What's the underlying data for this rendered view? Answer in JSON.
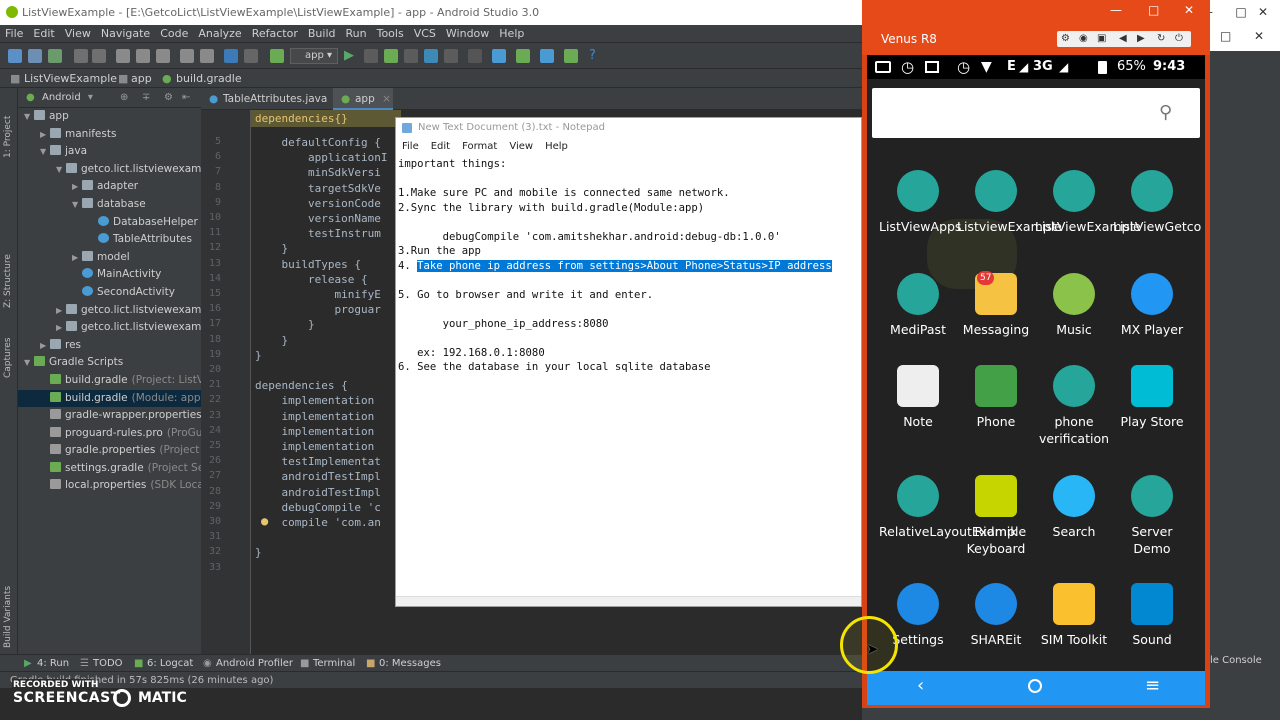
{
  "window": {
    "title": "ListViewExample - [E:\\GetcoLict\\ListViewExample\\ListViewExample] - app - Android Studio 3.0"
  },
  "menu": [
    "File",
    "Edit",
    "View",
    "Navigate",
    "Code",
    "Analyze",
    "Refactor",
    "Build",
    "Run",
    "Tools",
    "VCS",
    "Window",
    "Help"
  ],
  "toolbar": {
    "run_config": "app"
  },
  "breadcrumb": [
    "ListViewExample",
    "app",
    "build.gradle"
  ],
  "project": {
    "view": "Android",
    "items": [
      {
        "label": "app",
        "depth": 0,
        "arrow": "▼",
        "kind": "folder"
      },
      {
        "label": "manifests",
        "depth": 1,
        "arrow": "▶",
        "kind": "folder"
      },
      {
        "label": "java",
        "depth": 1,
        "arrow": "▼",
        "kind": "folder"
      },
      {
        "label": "getco.lict.listviewexample",
        "depth": 2,
        "arrow": "▼",
        "kind": "folder"
      },
      {
        "label": "adapter",
        "depth": 3,
        "arrow": "▶",
        "kind": "folder"
      },
      {
        "label": "database",
        "depth": 3,
        "arrow": "▼",
        "kind": "folder"
      },
      {
        "label": "DatabaseHelper",
        "depth": 4,
        "arrow": "",
        "kind": "class"
      },
      {
        "label": "TableAttributes",
        "depth": 4,
        "arrow": "",
        "kind": "class"
      },
      {
        "label": "model",
        "depth": 3,
        "arrow": "▶",
        "kind": "folder"
      },
      {
        "label": "MainActivity",
        "depth": 3,
        "arrow": "",
        "kind": "class"
      },
      {
        "label": "SecondActivity",
        "depth": 3,
        "arrow": "",
        "kind": "class"
      },
      {
        "label": "getco.lict.listviewexample",
        "depth": 2,
        "arrow": "▶",
        "kind": "folder"
      },
      {
        "label": "getco.lict.listviewexample",
        "depth": 2,
        "arrow": "▶",
        "kind": "folder"
      },
      {
        "label": "res",
        "depth": 1,
        "arrow": "▶",
        "kind": "folder"
      },
      {
        "label": "Gradle Scripts",
        "depth": 0,
        "arrow": "▼",
        "kind": "gradle"
      },
      {
        "label": "build.gradle",
        "depth": 1,
        "arrow": "",
        "kind": "gradle",
        "note": "(Project: ListVi"
      },
      {
        "label": "build.gradle",
        "depth": 1,
        "arrow": "",
        "kind": "gradle",
        "note": "(Module: app)",
        "selected": true
      },
      {
        "label": "gradle-wrapper.properties",
        "depth": 1,
        "arrow": "",
        "kind": "prop",
        "note": "(G"
      },
      {
        "label": "proguard-rules.pro",
        "depth": 1,
        "arrow": "",
        "kind": "prop",
        "note": "(ProGua"
      },
      {
        "label": "gradle.properties",
        "depth": 1,
        "arrow": "",
        "kind": "prop",
        "note": "(Project Pr"
      },
      {
        "label": "settings.gradle",
        "depth": 1,
        "arrow": "",
        "kind": "gradle",
        "note": "(Project Settin"
      },
      {
        "label": "local.properties",
        "depth": 1,
        "arrow": "",
        "kind": "prop",
        "note": "(SDK Locati"
      }
    ]
  },
  "tabs": [
    {
      "label": "TableAttributes.java"
    },
    {
      "label": "app"
    }
  ],
  "editor": {
    "breadcrumb": "dependencies{}",
    "lines": [
      {
        "n": "5",
        "t": "    defaultConfig {"
      },
      {
        "n": "6",
        "t": "        applicationI"
      },
      {
        "n": "7",
        "t": "        minSdkVersi"
      },
      {
        "n": "8",
        "t": "        targetSdkVe"
      },
      {
        "n": "9",
        "t": "        versionCode"
      },
      {
        "n": "10",
        "t": "        versionName"
      },
      {
        "n": "11",
        "t": "        testInstrum"
      },
      {
        "n": "12",
        "t": "    }"
      },
      {
        "n": "13",
        "t": "    buildTypes {"
      },
      {
        "n": "14",
        "t": "        release {"
      },
      {
        "n": "15",
        "t": "            minifyE"
      },
      {
        "n": "16",
        "t": "            proguar"
      },
      {
        "n": "17",
        "t": "        }"
      },
      {
        "n": "18",
        "t": "    }"
      },
      {
        "n": "19",
        "t": "}"
      },
      {
        "n": "20",
        "t": ""
      },
      {
        "n": "21",
        "t": "dependencies {"
      },
      {
        "n": "22",
        "t": "    implementation"
      },
      {
        "n": "23",
        "t": "    implementation"
      },
      {
        "n": "24",
        "t": "    implementation"
      },
      {
        "n": "25",
        "t": "    implementation"
      },
      {
        "n": "26",
        "t": "    testImplementat"
      },
      {
        "n": "27",
        "t": "    androidTestImpl"
      },
      {
        "n": "28",
        "t": "    androidTestImpl"
      },
      {
        "n": "29",
        "t": "    debugCompile 'c"
      },
      {
        "n": "30",
        "t": "    compile 'com.an"
      },
      {
        "n": "31",
        "t": ""
      },
      {
        "n": "32",
        "t": "}"
      },
      {
        "n": "33",
        "t": ""
      }
    ]
  },
  "notepad": {
    "title": "New Text Document (3).txt - Notepad",
    "menu": [
      "File",
      "Edit",
      "Format",
      "View",
      "Help"
    ],
    "lines": [
      {
        "t": "important things:"
      },
      {
        "t": ""
      },
      {
        "t": "1.Make sure PC and mobile is connected same network."
      },
      {
        "t": "2.Sync the library with build.gradle(Module:app)"
      },
      {
        "t": ""
      },
      {
        "t": "       debugCompile 'com.amitshekhar.android:debug-db:1.0.0'"
      },
      {
        "t": "3.Run the app"
      },
      {
        "t": "4. ",
        "hl": "Take phone ip address from settings>About Phone>Status>IP address"
      },
      {
        "t": ""
      },
      {
        "t": "5. Go to browser and write it and enter."
      },
      {
        "t": ""
      },
      {
        "t": "       your_phone_ip_address:8080"
      },
      {
        "t": ""
      },
      {
        "t": "   ex: 192.168.0.1:8080"
      },
      {
        "t": "6. See the database in your local sqlite database"
      }
    ]
  },
  "bottom_tabs": [
    "4: Run",
    "TODO",
    "6: Logcat",
    "Android Profiler",
    "Terminal",
    "0: Messages"
  ],
  "status": {
    "text": "Gradle build finished in 57s 825ms (26 minutes ago)",
    "console": "le Console"
  },
  "watermark": {
    "line1": "RECORDED WITH",
    "brand": "SCREENCAST",
    "brand2": "MATIC"
  },
  "phone": {
    "device": "Venus R8",
    "status": {
      "network": "E",
      "net2": "3G",
      "battery": "65%",
      "time": "9:43 pm"
    },
    "apps": [
      {
        "label": "ListViewApps",
        "icon": "android-icon",
        "color": "#26a69a"
      },
      {
        "label": "ListviewExample",
        "icon": "android-icon",
        "color": "#26a69a"
      },
      {
        "label": "ListViewExample",
        "icon": "android-icon",
        "color": "#26a69a"
      },
      {
        "label": "ListViewGetco",
        "icon": "android-icon",
        "color": "#26a69a"
      },
      {
        "label": "MediPast",
        "icon": "android-icon",
        "color": "#26a69a"
      },
      {
        "label": "Messaging",
        "icon": "messaging-icon",
        "color": "#f5c242",
        "badge": "57"
      },
      {
        "label": "Music",
        "icon": "music-icon",
        "color": "#8bc34a"
      },
      {
        "label": "MX Player",
        "icon": "play-icon",
        "color": "#2196f3"
      },
      {
        "label": "Note",
        "icon": "note-icon",
        "color": "#eeeeee"
      },
      {
        "label": "Phone",
        "icon": "phone-icon",
        "color": "#43a047"
      },
      {
        "label": "phone verification",
        "icon": "android-icon",
        "color": "#26a69a"
      },
      {
        "label": "Play Store",
        "icon": "play-store-icon",
        "color": "#00bcd4"
      },
      {
        "label": "RelativeLayoutExample",
        "icon": "android-icon",
        "color": "#26a69a"
      },
      {
        "label": "Ridmik Keyboard",
        "icon": "keyboard-icon",
        "color": "#c6d500"
      },
      {
        "label": "Search",
        "icon": "search-icon",
        "color": "#29b6f6"
      },
      {
        "label": "Server Demo",
        "icon": "android-icon",
        "color": "#26a69a"
      },
      {
        "label": "Settings",
        "icon": "gear-icon",
        "color": "#1e88e5"
      },
      {
        "label": "SHAREit",
        "icon": "shareit-icon",
        "color": "#1e88e5"
      },
      {
        "label": "SIM Toolkit",
        "icon": "sim-icon",
        "color": "#fbc02d"
      },
      {
        "label": "Sound",
        "icon": "sound-icon",
        "color": "#0288d1"
      }
    ]
  }
}
